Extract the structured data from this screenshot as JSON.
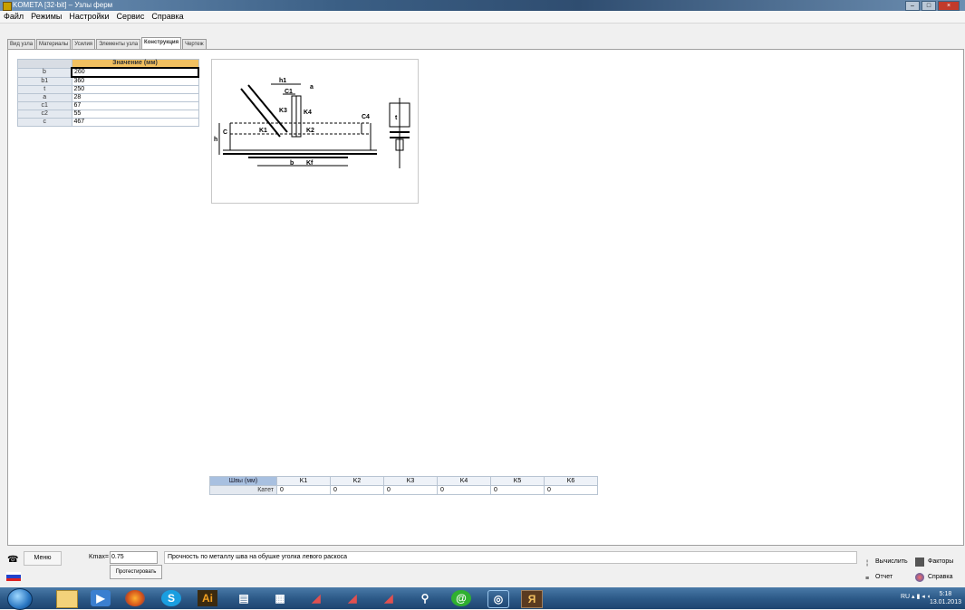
{
  "window": {
    "title": "KOMETA [32-bit] – Узлы ферм"
  },
  "menu": {
    "items": [
      "Файл",
      "Режимы",
      "Настройки",
      "Сервис",
      "Справка"
    ]
  },
  "tabs": [
    "Вид узла",
    "Материалы",
    "Усилия",
    "Элементы узла",
    "Конструкция",
    "Чертеж"
  ],
  "active_tab": "Конструкция",
  "params_table": {
    "header": "Значение (мм)",
    "rows": [
      {
        "name": "b",
        "value": "260"
      },
      {
        "name": "b1",
        "value": "360"
      },
      {
        "name": "t",
        "value": "250"
      },
      {
        "name": "a",
        "value": "28"
      },
      {
        "name": "c1",
        "value": "67"
      },
      {
        "name": "c2",
        "value": "55"
      },
      {
        "name": "c",
        "value": "467"
      }
    ]
  },
  "drawing_labels": {
    "h1": "h1",
    "c1": "C1",
    "a": "a",
    "k3": "K3",
    "k4": "K4",
    "k1": "K1",
    "k2": "K2",
    "c4": "C4",
    "h": "h",
    "c": "C",
    "b": "b",
    "kf": "Kf",
    "t": "t"
  },
  "weld_table": {
    "corner": "Швы (мм)",
    "columns": [
      "K1",
      "K2",
      "K3",
      "K4",
      "K5",
      "K6"
    ],
    "row_label": "Катет",
    "values": [
      "0",
      "0",
      "0",
      "0",
      "0",
      "0"
    ]
  },
  "status": {
    "menu_button": "Меню",
    "k_label": "Kmax=",
    "k_value": "0.75",
    "test_button": "Протестировать",
    "message": "Прочность по металлу шва на обушке уголка левого раскоса",
    "calc_button": "Вычислить",
    "factors_button": "Факторы",
    "report_button": "Отчет",
    "help_button": "Справка"
  },
  "taskbar": {
    "lang": "RU",
    "time": "5:18",
    "date": "13.01.2013"
  },
  "colors": {
    "table_header": "#f2c060",
    "title_bar": "#3b5f85",
    "taskbar": "#2d5a88"
  }
}
